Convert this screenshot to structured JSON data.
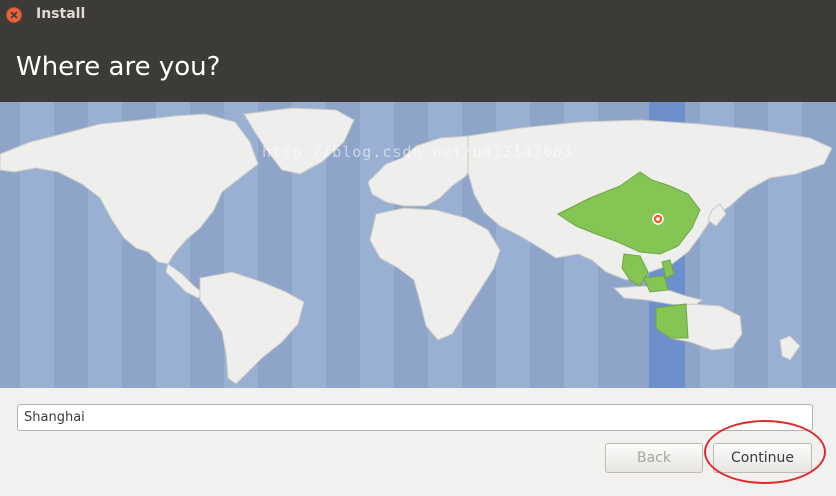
{
  "window": {
    "title": "Install"
  },
  "header": {
    "title": "Where are you?"
  },
  "map": {
    "selected_zone": "Shanghai",
    "watermark": "http://blog.csdn.net/u013142003",
    "colors": {
      "water": "#8ea4c9",
      "land": "#eeeeec",
      "selected": "#85c553",
      "zone": "#6d8fcc",
      "marker": "#e9633b"
    }
  },
  "location": {
    "value": "Shanghai"
  },
  "buttons": {
    "back": "Back",
    "continue": "Continue"
  }
}
